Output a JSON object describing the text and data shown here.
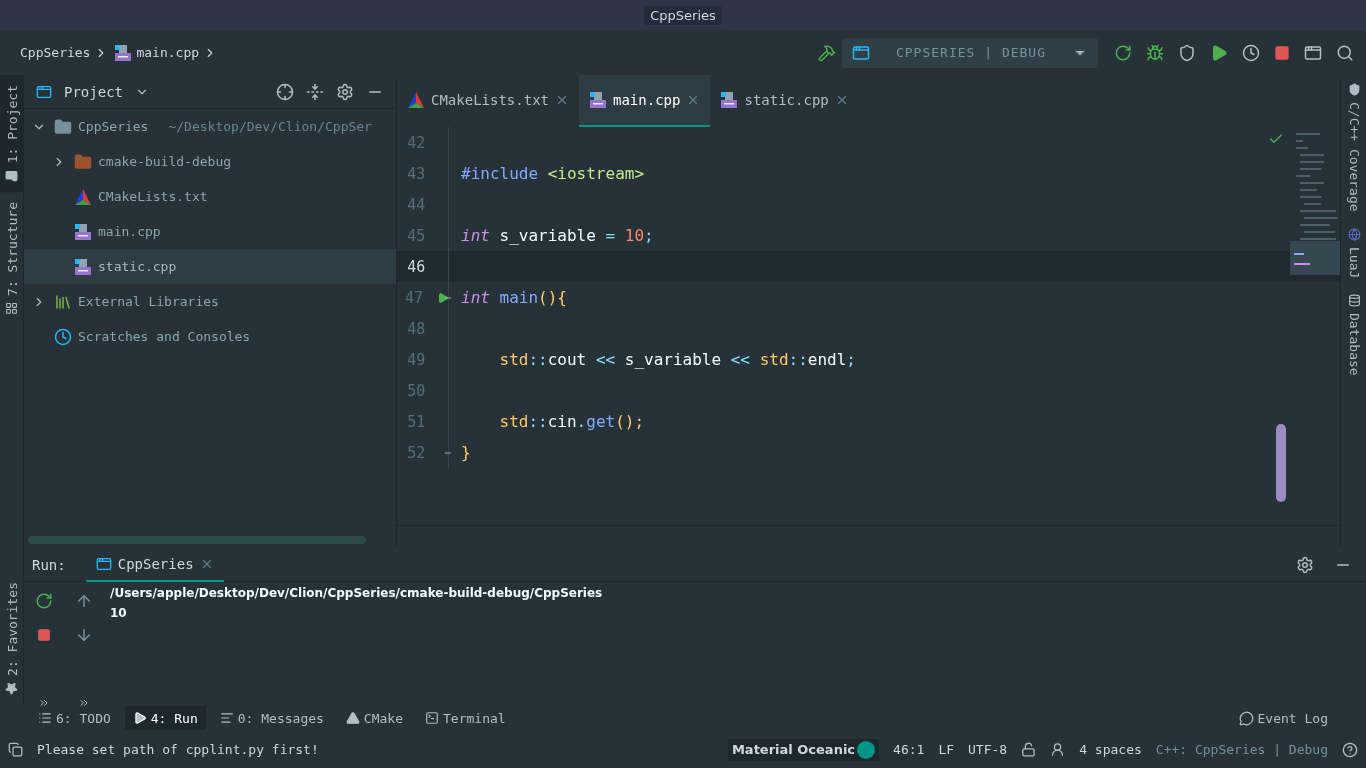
{
  "window": {
    "title": "CppSeries"
  },
  "breadcrumb": [
    {
      "label": "CppSeries",
      "kind": "project"
    },
    {
      "label": "main.cpp",
      "kind": "cpp"
    }
  ],
  "run_config": {
    "label": "CPPSERIES | DEBUG"
  },
  "left_strip": [
    {
      "label": "1: Project",
      "kind": "folder",
      "selected": true
    },
    {
      "label": "7: Structure",
      "kind": "structure",
      "selected": false
    }
  ],
  "left_strip_bottom": [
    {
      "label": "2: Favorites",
      "kind": "star",
      "selected": false
    }
  ],
  "project_panel": {
    "title": "Project"
  },
  "tree": [
    {
      "label": "CppSeries",
      "detail": "~/Desktop/Dev/Clion/CppSer",
      "kind": "folder",
      "expanded": true,
      "selected": false,
      "children": [
        {
          "label": "cmake-build-debug",
          "kind": "build-folder",
          "expanded": false,
          "selected": false
        },
        {
          "label": "CMakeLists.txt",
          "kind": "cmake",
          "selected": false
        },
        {
          "label": "main.cpp",
          "kind": "cpp",
          "selected": false
        },
        {
          "label": "static.cpp",
          "kind": "cpp",
          "selected": true
        }
      ]
    },
    {
      "label": "External Libraries",
      "kind": "libraries",
      "expanded": false,
      "selected": false
    },
    {
      "label": "Scratches and Consoles",
      "kind": "scratches",
      "selected": false
    }
  ],
  "tabs": [
    {
      "label": "CMakeLists.txt",
      "kind": "cmake",
      "selected": false
    },
    {
      "label": "main.cpp",
      "kind": "cpp",
      "selected": true
    },
    {
      "label": "static.cpp",
      "kind": "cpp",
      "selected": false
    }
  ],
  "code": [
    {
      "number": "42",
      "current": false
    },
    {
      "number": "43",
      "current": false,
      "tokens": [
        {
          "text": "#include",
          "kind": "preproc"
        },
        {
          "text": " <iostream>",
          "kind": "header"
        }
      ]
    },
    {
      "number": "44",
      "current": false
    },
    {
      "number": "45",
      "current": false,
      "tokens": [
        {
          "text": "int",
          "kind": "keyword"
        },
        {
          "text": " s_variable ",
          "kind": "plain"
        },
        {
          "text": "=",
          "kind": "operator"
        },
        {
          "text": " 10",
          "kind": "number"
        },
        {
          "text": ";",
          "kind": "operator"
        }
      ]
    },
    {
      "number": "46",
      "current": true
    },
    {
      "number": "47",
      "current": false,
      "run": true,
      "fold_marker": true,
      "tokens": [
        {
          "text": "int",
          "kind": "keyword"
        },
        {
          "text": " main",
          "kind": "function"
        },
        {
          "text": "(){",
          "kind": "brace"
        }
      ]
    },
    {
      "number": "48",
      "current": false
    },
    {
      "number": "49",
      "current": false,
      "tokens": [
        {
          "text": "    std",
          "kind": "namespace"
        },
        {
          "text": "::",
          "kind": "operator"
        },
        {
          "text": "cout ",
          "kind": "plain"
        },
        {
          "text": "<<",
          "kind": "operator"
        },
        {
          "text": " s_variable ",
          "kind": "plain"
        },
        {
          "text": "<<",
          "kind": "operator"
        },
        {
          "text": " std",
          "kind": "namespace"
        },
        {
          "text": "::",
          "kind": "operator"
        },
        {
          "text": "endl",
          "kind": "plain"
        },
        {
          "text": ";",
          "kind": "operator"
        }
      ]
    },
    {
      "number": "50",
      "current": false
    },
    {
      "number": "51",
      "current": false,
      "tokens": [
        {
          "text": "    std",
          "kind": "namespace"
        },
        {
          "text": "::",
          "kind": "operator"
        },
        {
          "text": "cin",
          "kind": "plain"
        },
        {
          "text": ".",
          "kind": "operator"
        },
        {
          "text": "get",
          "kind": "function"
        },
        {
          "text": "();",
          "kind": "brace"
        }
      ]
    },
    {
      "number": "52",
      "current": false,
      "fold_marker": true,
      "tokens": [
        {
          "text": "}",
          "kind": "brace"
        }
      ]
    }
  ],
  "right_strip": [
    {
      "label": "C/C++ Coverage",
      "kind": "shield"
    },
    {
      "label": "LuaJ",
      "kind": "lua"
    },
    {
      "label": "Database",
      "kind": "database"
    }
  ],
  "run_panel": {
    "label": "Run:",
    "tabs": [
      {
        "label": "CppSeries",
        "selected": true
      }
    ],
    "output": [
      "/Users/apple/Desktop/Dev/Clion/CppSeries/cmake-build-debug/CppSeries",
      "10"
    ]
  },
  "tool_tabs": [
    {
      "label": "6: TODO",
      "kind": "list",
      "selected": false
    },
    {
      "label": "4: Run",
      "kind": "run",
      "selected": true
    },
    {
      "label": "0: Messages",
      "kind": "messages",
      "selected": false
    },
    {
      "label": "CMake",
      "kind": "cmake",
      "selected": false
    },
    {
      "label": "Terminal",
      "kind": "terminal",
      "selected": false
    }
  ],
  "event_log": {
    "label": "Event Log"
  },
  "status_bar": {
    "message": "Please set path of cpplint.py first!",
    "theme": "Material Oceanic",
    "position": "46:1",
    "line_ending": "LF",
    "encoding": "UTF-8",
    "indent": "4 spaces",
    "context": "C++: CppSeries | Debug"
  }
}
